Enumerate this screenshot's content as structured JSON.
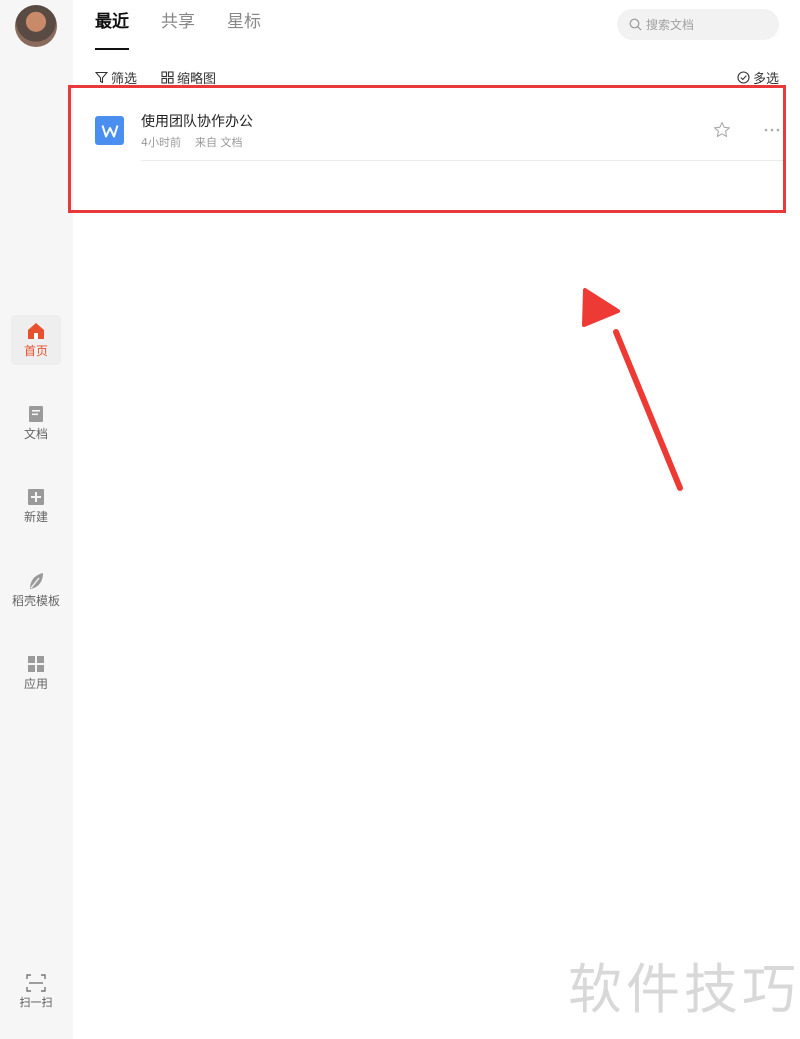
{
  "sidebar": {
    "avatar_alt": "用户头像",
    "items": [
      {
        "label": "首页",
        "icon": "home-icon",
        "active": true
      },
      {
        "label": "文档",
        "icon": "document-icon",
        "active": false
      },
      {
        "label": "新建",
        "icon": "plus-icon",
        "active": false
      },
      {
        "label": "稻壳模板",
        "icon": "leaf-icon",
        "active": false
      },
      {
        "label": "应用",
        "icon": "grid-icon",
        "active": false
      }
    ],
    "scan_label": "扫一扫"
  },
  "tabs": [
    {
      "label": "最近",
      "active": true
    },
    {
      "label": "共享",
      "active": false
    },
    {
      "label": "星标",
      "active": false
    }
  ],
  "search": {
    "placeholder": "搜索文档"
  },
  "toolbar": {
    "filter_label": "筛选",
    "thumbnail_label": "缩略图",
    "multiselect_label": "多选"
  },
  "documents": [
    {
      "title": "使用团队协作办公",
      "time": "4小时前",
      "source": "来自 文档",
      "icon": "word-doc-icon"
    }
  ],
  "annotation": {
    "highlight_color": "#e83a3a"
  },
  "watermark": "软件技巧",
  "colors": {
    "accent": "#e8512e",
    "doc_blue": "#4a8ef0"
  }
}
